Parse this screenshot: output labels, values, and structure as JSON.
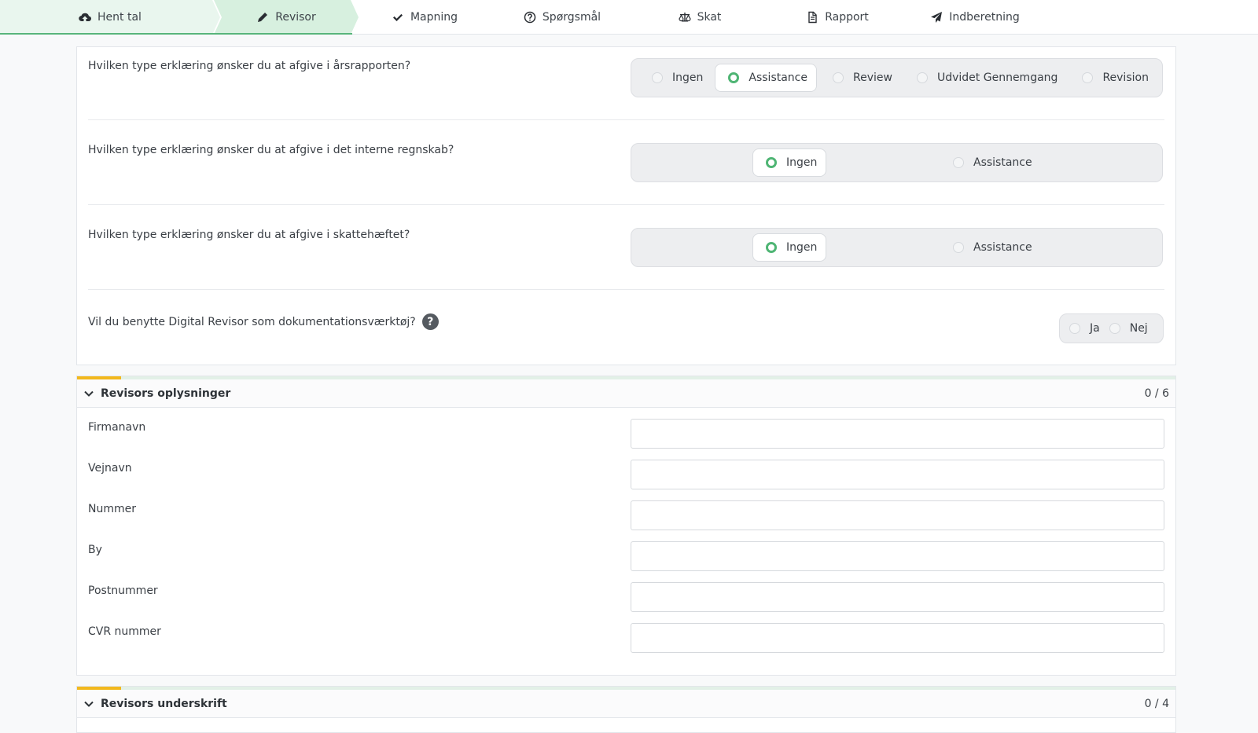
{
  "stepper": [
    {
      "label": "Hent tal",
      "icon": "cloud-download-icon"
    },
    {
      "label": "Revisor",
      "icon": "pencil-icon"
    },
    {
      "label": "Mapning",
      "icon": "check-icon"
    },
    {
      "label": "Spørgsmål",
      "icon": "question-circle-icon"
    },
    {
      "label": "Skat",
      "icon": "scale-icon"
    },
    {
      "label": "Rapport",
      "icon": "file-icon"
    },
    {
      "label": "Indberetning",
      "icon": "paper-plane-icon"
    }
  ],
  "questions": [
    {
      "text": "Hvilken type erklæring ønsker du at afgive i årsrapporten?",
      "options": [
        "Ingen",
        "Assistance",
        "Review",
        "Udvidet Gennemgang",
        "Revision"
      ],
      "selected": "Assistance"
    },
    {
      "text": "Hvilken type erklæring ønsker du at afgive i det interne regnskab?",
      "options": [
        "Ingen",
        "Assistance"
      ],
      "selected": "Ingen"
    },
    {
      "text": "Hvilken type erklæring ønsker du at afgive i skattehæftet?",
      "options": [
        "Ingen",
        "Assistance"
      ],
      "selected": "Ingen"
    },
    {
      "text": "Vil du benytte Digital Revisor som dokumentationsværktøj?",
      "help_icon": "question-circle-icon",
      "options": [
        "Ja",
        "Nej"
      ],
      "selected": null
    }
  ],
  "revisor_section": {
    "title": "Revisors oplysninger",
    "count": "0 / 6",
    "progress": 0,
    "fields": [
      {
        "label": "Firmanavn",
        "value": ""
      },
      {
        "label": "Vejnavn",
        "value": ""
      },
      {
        "label": "Nummer",
        "value": ""
      },
      {
        "label": "By",
        "value": ""
      },
      {
        "label": "Postnummer",
        "value": ""
      },
      {
        "label": "CVR nummer",
        "value": ""
      }
    ]
  },
  "signature_section": {
    "title": "Revisors underskrift",
    "count": "0 / 4",
    "progress": 0
  },
  "colors": {
    "accent_green": "#4fb574",
    "progress_yellow": "#f2b81c",
    "step_done_bg": "#e9f6ee",
    "step_active_bg": "#d7f0df"
  }
}
